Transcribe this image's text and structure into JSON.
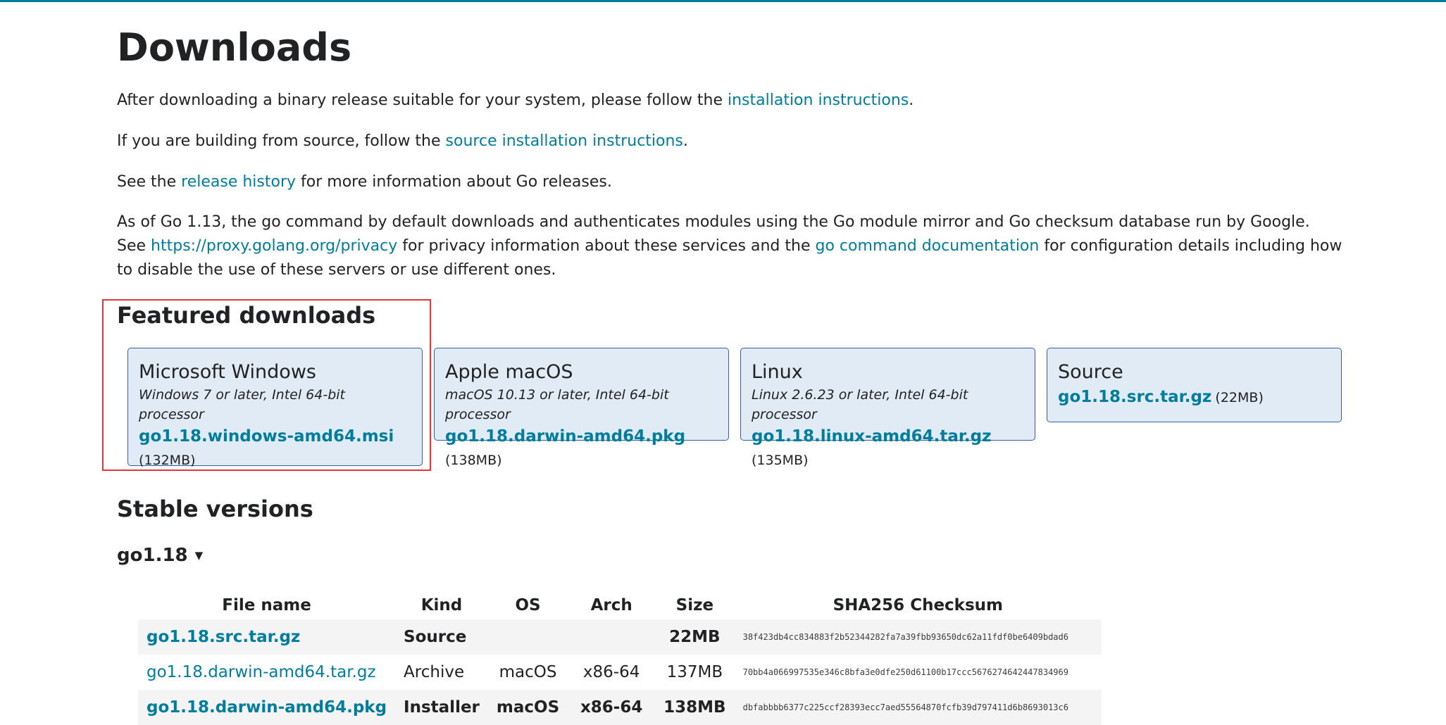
{
  "page": {
    "title": "Downloads",
    "p1": {
      "before": "After downloading a binary release suitable for your system, please follow the ",
      "link": "installation instructions",
      "after": "."
    },
    "p2": {
      "before": "If you are building from source, follow the ",
      "link": "source installation instructions",
      "after": "."
    },
    "p3": {
      "before": "See the ",
      "link": "release history",
      "after": " for more information about Go releases."
    },
    "p4": {
      "text1": "As of Go 1.13, the go command by default downloads and authenticates modules using the Go module mirror and Go checksum database run by Google. See ",
      "link1": "https://proxy.golang.org/privacy",
      "text2": " for privacy information about these services and the ",
      "link2": "go command documentation",
      "text3": " for configuration details including how to disable the use of these servers or use different ones."
    }
  },
  "featured": {
    "heading": "Featured downloads",
    "cards": [
      {
        "os": "Microsoft Windows",
        "req": "Windows 7 or later, Intel 64-bit processor",
        "file": "go1.18.windows-amd64.msi",
        "size": "(132MB)"
      },
      {
        "os": "Apple macOS",
        "req": "macOS 10.13 or later, Intel 64-bit processor",
        "file": "go1.18.darwin-amd64.pkg",
        "size": "(138MB)"
      },
      {
        "os": "Linux",
        "req": "Linux 2.6.23 or later, Intel 64-bit processor",
        "file": "go1.18.linux-amd64.tar.gz",
        "size": "(135MB)"
      },
      {
        "os": "Source",
        "file": "go1.18.src.tar.gz",
        "size": "(22MB)"
      }
    ]
  },
  "stable": {
    "heading": "Stable versions",
    "version": "go1.18",
    "caret": "▼",
    "columns": [
      "File name",
      "Kind",
      "OS",
      "Arch",
      "Size",
      "SHA256 Checksum"
    ],
    "rows": [
      {
        "file": "go1.18.src.tar.gz",
        "kind": "Source",
        "os": "",
        "arch": "",
        "size": "22MB",
        "sum": "38f423db4cc834883f2b52344282fa7a39fbb93650dc62a11fdf0be6409bdad6"
      },
      {
        "file": "go1.18.darwin-amd64.tar.gz",
        "kind": "Archive",
        "os": "macOS",
        "arch": "x86-64",
        "size": "137MB",
        "sum": "70bb4a066997535e346c8bfa3e0dfe250d61100b17ccc5676274642447834969"
      },
      {
        "file": "go1.18.darwin-amd64.pkg",
        "kind": "Installer",
        "os": "macOS",
        "arch": "x86-64",
        "size": "138MB",
        "sum": "dbfabbbb6377c225ccf28393ecc7aed55564870fcfb39d797411d6b8693013c6"
      }
    ]
  }
}
